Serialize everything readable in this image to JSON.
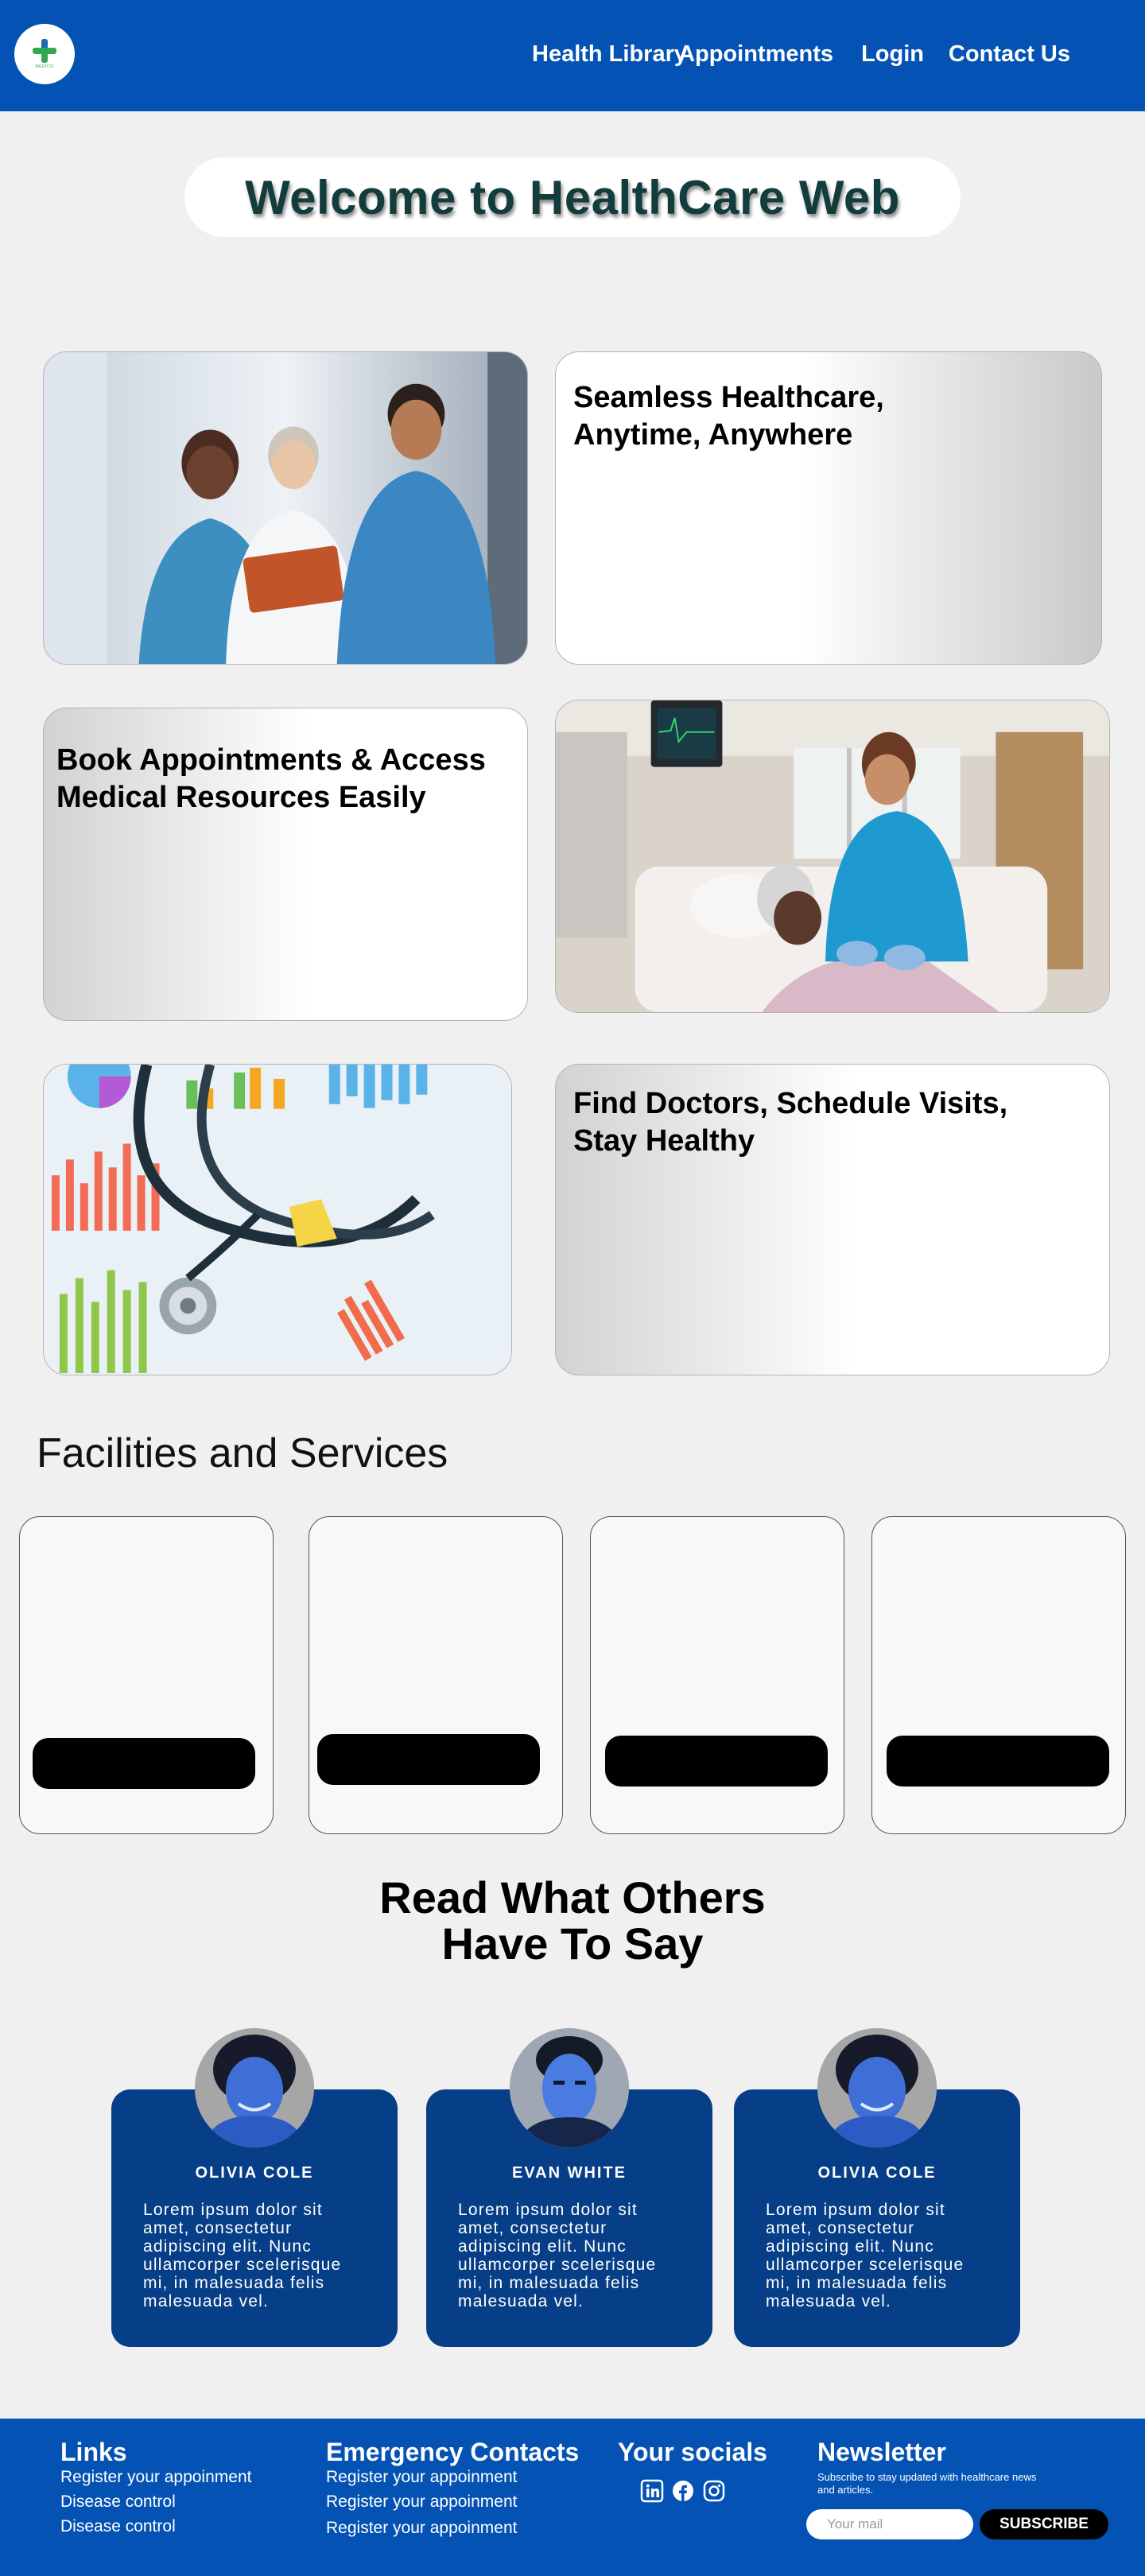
{
  "header": {
    "logo_text": "MEDICO",
    "nav": [
      "Health Library",
      "Appointments",
      "Login",
      "Contact Us"
    ]
  },
  "welcome": {
    "title": "Welcome to HealthCare Web"
  },
  "hero": {
    "card1_text": "Seamless Healthcare,\nAnytime, Anywhere",
    "card2_text": "Book Appointments & Access\nMedical Resources Easily",
    "card3_text": "Find Doctors, Schedule Visits,\nStay Healthy"
  },
  "facilities": {
    "title": "Facilities and Services"
  },
  "testimonials": {
    "title": "Read What Others\nHave To Say",
    "items": [
      {
        "name": "OLIVIA COLE",
        "text": "Lorem ipsum dolor sit amet, consectetur adipiscing elit. Nunc ullamcorper scelerisque mi, in malesuada felis malesuada vel."
      },
      {
        "name": "EVAN WHITE",
        "text": "Lorem ipsum dolor sit amet, consectetur adipiscing elit. Nunc ullamcorper scelerisque mi, in malesuada felis malesuada vel."
      },
      {
        "name": "OLIVIA COLE",
        "text": "Lorem ipsum dolor sit amet, consectetur adipiscing elit. Nunc ullamcorper scelerisque mi, in malesuada felis malesuada vel."
      }
    ]
  },
  "footer": {
    "links_title": "Links",
    "links": [
      "Register your appoinment",
      "Disease control",
      "Disease control"
    ],
    "emergency_title": "Emergency Contacts",
    "emergency": [
      "Register your appoinment",
      "Register your appoinment",
      "Register your appoinment"
    ],
    "socials_title": "Your socials",
    "socials": [
      "linkedin-icon",
      "facebook-icon",
      "instagram-icon"
    ],
    "newsletter_title": "Newsletter",
    "newsletter_desc": "Subscribe to stay updated with healthcare news and articles.",
    "email_placeholder": "Your mail",
    "subscribe_label": "SUBSCRIBE"
  },
  "colors": {
    "primary": "#0453b4",
    "card_blue": "#063e87",
    "title": "#133c3d"
  }
}
